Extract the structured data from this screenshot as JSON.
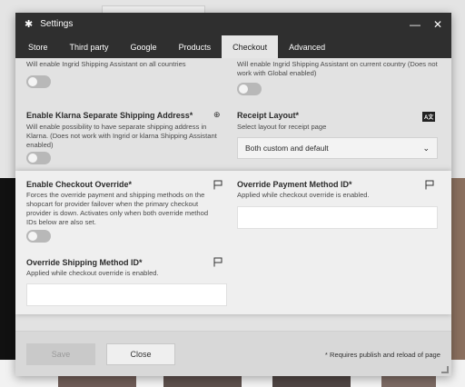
{
  "window": {
    "title": "Settings",
    "minimize_glyph": "—",
    "close_glyph": "✕"
  },
  "tabs": [
    {
      "label": "Store",
      "active": false
    },
    {
      "label": "Third party",
      "active": false
    },
    {
      "label": "Google",
      "active": false
    },
    {
      "label": "Products",
      "active": false
    },
    {
      "label": "Checkout",
      "active": true
    },
    {
      "label": "Advanced",
      "active": false
    }
  ],
  "settings": {
    "all_countries": {
      "help": "Will enable Ingrid Shipping Assistant on all countries",
      "enabled": false
    },
    "current_country": {
      "help": "Will enable Ingrid Shipping Assistant on current country (Does not work with Global enabled)",
      "enabled": false
    },
    "klarna_shipping": {
      "label": "Enable Klarna Separate Shipping Address*",
      "help": "Will enable possibility to have separate shipping address in Klarna. (Does not work with Ingrid or klarna Shipping Assistant enabled)",
      "enabled": false,
      "icon": "globe-icon"
    },
    "receipt_layout": {
      "label": "Receipt Layout*",
      "help": "Select layout for receipt page",
      "selected": "Both custom and default",
      "badge": "A文"
    },
    "checkout_override": {
      "label": "Enable Checkout Override*",
      "help": "Forces the override payment and shipping methods on the shopcart for provider failover when the primary checkout provider is down. Activates only when both override method IDs below are also set.",
      "enabled": false,
      "icon": "flag-icon"
    },
    "override_payment": {
      "label": "Override Payment Method ID*",
      "help": "Applied while checkout override is enabled.",
      "value": "",
      "icon": "flag-icon"
    },
    "override_shipping": {
      "label": "Override Shipping Method ID*",
      "help": "Applied while checkout override is enabled.",
      "value": "",
      "icon": "flag-icon"
    }
  },
  "footer": {
    "save_label": "Save",
    "close_label": "Close",
    "note": "* Requires publish and reload of page"
  }
}
